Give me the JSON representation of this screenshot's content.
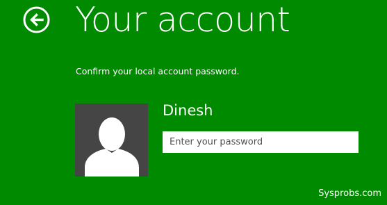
{
  "header": {
    "back_icon": "back-arrow-icon",
    "title": "Your account"
  },
  "content": {
    "instruction": "Confirm your local account password.",
    "user": {
      "avatar_icon": "user-silhouette-icon",
      "name": "Dinesh"
    },
    "password": {
      "value": "",
      "placeholder": "Enter your password"
    }
  },
  "watermark": "Sysprobs.com",
  "colors": {
    "background": "#008a00",
    "avatar_background": "#454545",
    "text": "#ffffff"
  }
}
